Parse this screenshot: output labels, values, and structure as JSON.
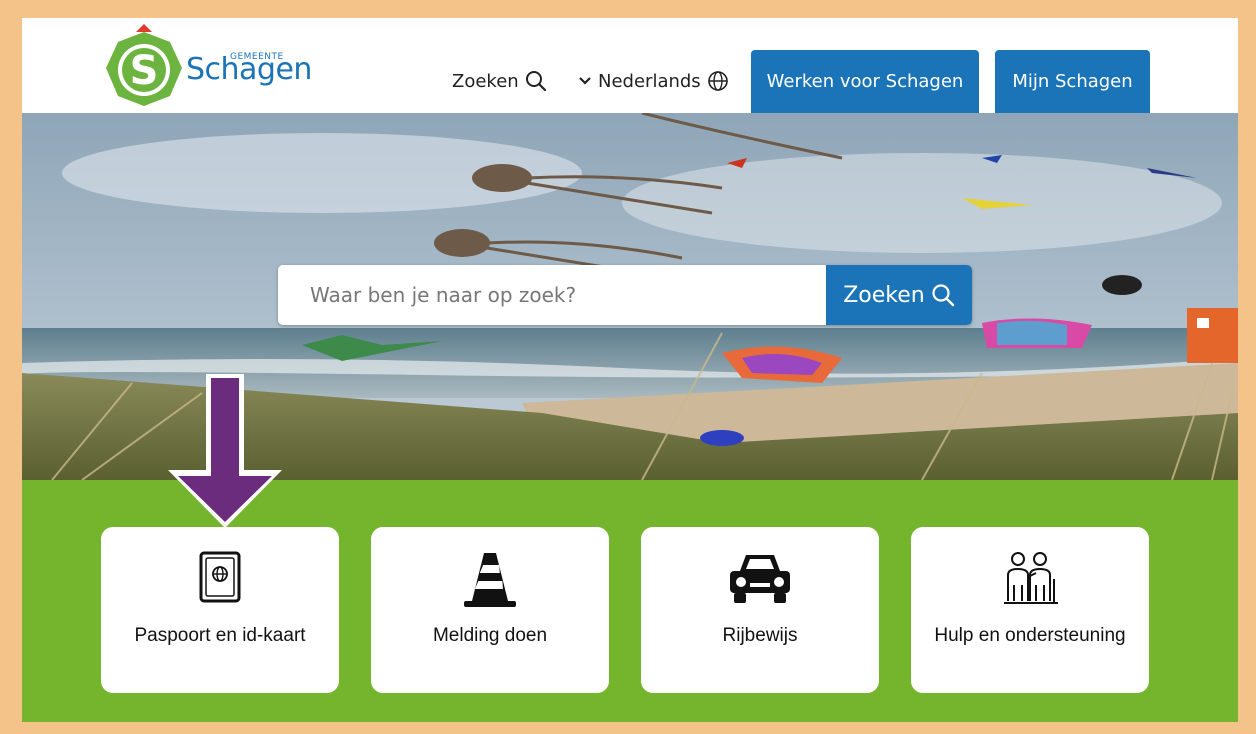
{
  "header": {
    "logo_small": "GEMEENTE",
    "logo_text": "Schagen",
    "search_label": "Zoeken",
    "language_label": "Nederlands",
    "buttons": [
      {
        "label": "Werken voor Schagen"
      },
      {
        "label": "Mijn Schagen"
      }
    ]
  },
  "hero": {
    "search_placeholder": "Waar ben je naar op zoek?",
    "search_button": "Zoeken"
  },
  "tiles": [
    {
      "label": "Paspoort en id-kaart",
      "icon": "passport-icon"
    },
    {
      "label": "Melding doen",
      "icon": "traffic-cone-icon"
    },
    {
      "label": "Rijbewijs",
      "icon": "car-icon"
    },
    {
      "label": "Hulp en ondersteuning",
      "icon": "people-support-icon"
    }
  ],
  "colors": {
    "frame": "#f3c389",
    "primary_blue": "#1b74b8",
    "green": "#74b52d",
    "arrow": "#6b2c7d"
  }
}
